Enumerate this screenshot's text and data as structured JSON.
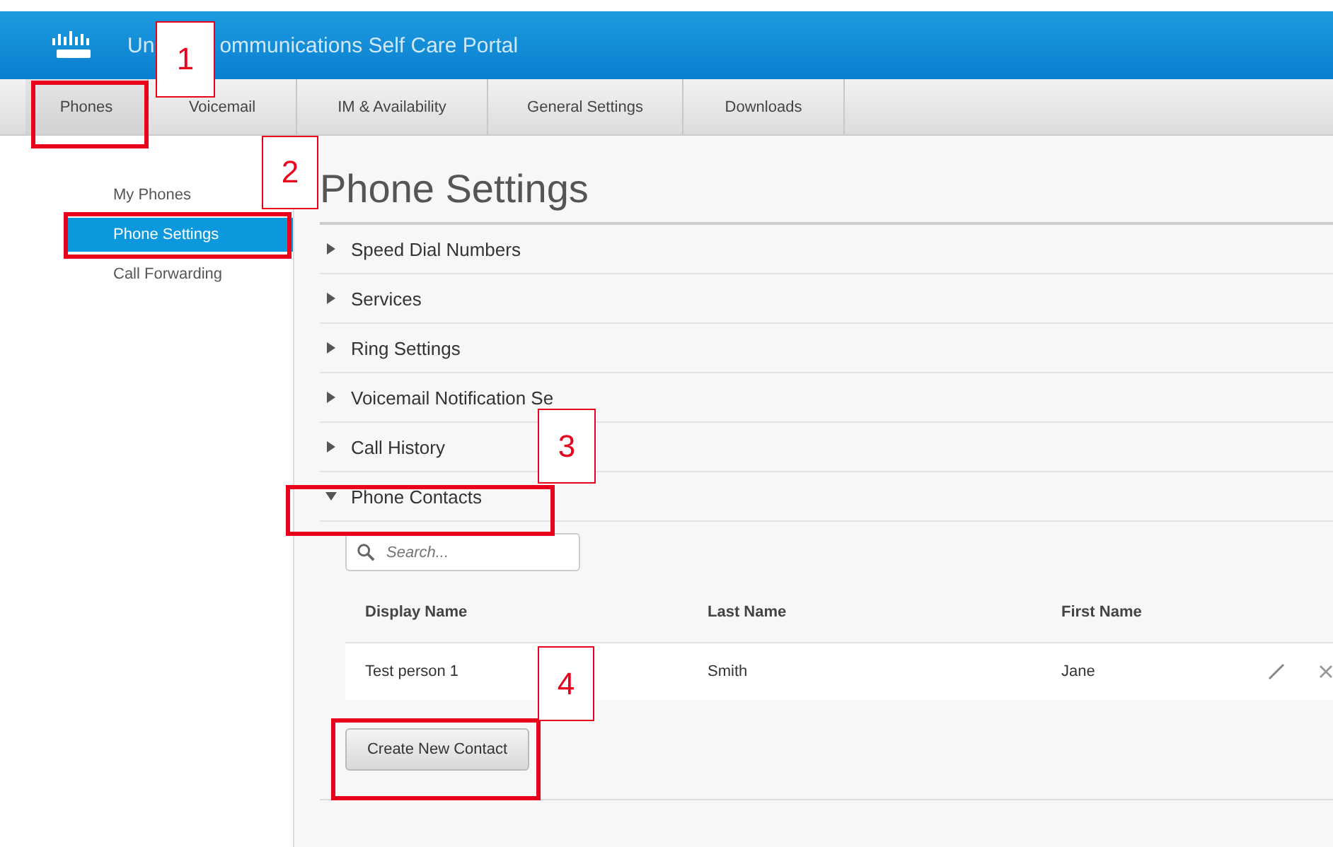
{
  "header": {
    "title_parts": [
      "Un",
      "ommunications Self Care Portal"
    ]
  },
  "tabs": [
    {
      "label": "Phones",
      "selected": true
    },
    {
      "label": "Voicemail",
      "selected": false
    },
    {
      "label": "IM & Availability",
      "selected": false
    },
    {
      "label": "General Settings",
      "selected": false
    },
    {
      "label": "Downloads",
      "selected": false
    }
  ],
  "sidebar": {
    "items": [
      {
        "label": "My Phones",
        "selected": false
      },
      {
        "label": "Phone Settings",
        "selected": true
      },
      {
        "label": "Call Forwarding",
        "selected": false
      }
    ]
  },
  "page_title": "Phone Settings",
  "sections": [
    {
      "label": "Speed Dial Numbers",
      "expanded": false
    },
    {
      "label": "Services",
      "expanded": false
    },
    {
      "label": "Ring Settings",
      "expanded": false
    },
    {
      "label": "Voicemail Notification Se",
      "expanded": false
    },
    {
      "label": "Call History",
      "expanded": false
    },
    {
      "label": "Phone Contacts",
      "expanded": true
    }
  ],
  "search": {
    "placeholder": "Search..."
  },
  "table": {
    "columns": [
      "Display Name",
      "Last Name",
      "First Name"
    ],
    "rows": [
      [
        "Test person 1",
        "Smith",
        "Jane"
      ]
    ]
  },
  "create_button": "Create New Contact",
  "annotations": [
    {
      "label": "1"
    },
    {
      "label": "2"
    },
    {
      "label": "3"
    },
    {
      "label": "4"
    }
  ]
}
